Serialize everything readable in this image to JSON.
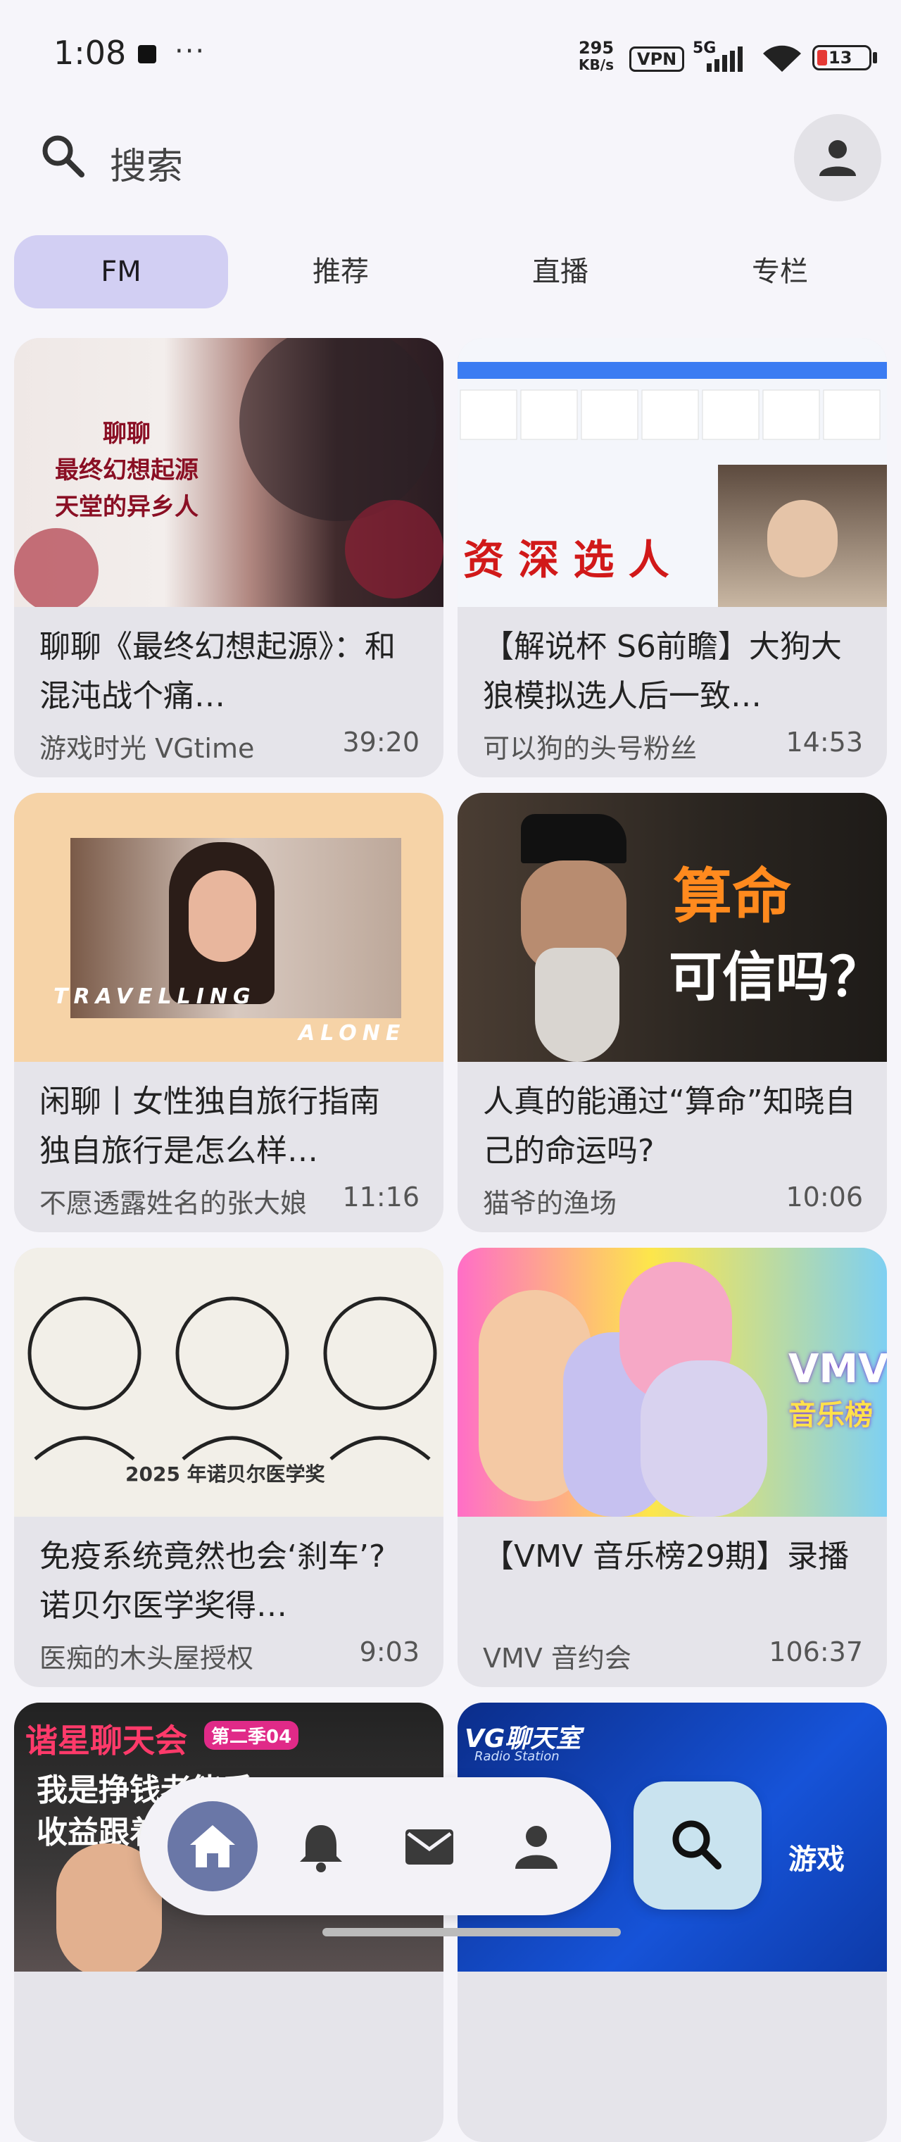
{
  "status_bar": {
    "time": "1:08",
    "dots": "···",
    "net_speed_value": "295",
    "net_speed_unit": "KB/s",
    "vpn": "VPN",
    "network": "5G",
    "battery": "13"
  },
  "search": {
    "placeholder": "搜索"
  },
  "tabs": [
    {
      "label": "FM",
      "active": true
    },
    {
      "label": "推荐",
      "active": false
    },
    {
      "label": "直播",
      "active": false
    },
    {
      "label": "专栏",
      "active": false
    }
  ],
  "cards": [
    {
      "title": "聊聊《最终幻想起源》：和混沌战个痛…",
      "author": "游戏时光 VGtime",
      "duration": "39:20",
      "thumb_text": [
        "聊聊",
        "最终幻想起源",
        "天堂的异乡人"
      ]
    },
    {
      "title": "【解说杯 S6前瞻】大狗大狼模拟选人后一致…",
      "author": "可以狗的头号粉丝",
      "duration": "14:53",
      "thumb_text": [
        "资 深 选 人"
      ]
    },
    {
      "title": "闲聊丨女性独自旅行指南 独自旅行是怎么样…",
      "author": "不愿透露姓名的张大娘",
      "duration": "11:16",
      "thumb_text": [
        "TRAVELLING",
        "ALONE"
      ]
    },
    {
      "title": "人真的能通过“算命”知晓自己的命运吗?",
      "author": "猫爷的渔场",
      "duration": "10:06",
      "thumb_text": [
        "算命",
        "可信吗？"
      ]
    },
    {
      "title": "免疫系统竟然也会‘刹车’? 诺贝尔医学奖得…",
      "author": "医痴的木头屋授权",
      "duration": "9:03",
      "thumb_text": [
        "2025 年诺贝尔医学奖"
      ]
    },
    {
      "title": "【VMV 音乐榜29期】录播",
      "author": "VMV 音约会",
      "duration": "106:37",
      "thumb_text": [
        "VMV",
        "音乐榜"
      ]
    },
    {
      "title": "",
      "author": "",
      "duration": "",
      "thumb_text": [
        "谐星聊天会",
        "第二季04",
        "我是挣钱老能手",
        "收益跟着"
      ]
    },
    {
      "title": "",
      "author": "",
      "duration": "",
      "thumb_text": [
        "VG聊天室",
        "Radio Station",
        "游戏"
      ]
    }
  ],
  "nav": {
    "items": [
      "home-icon",
      "bell-icon",
      "mail-icon",
      "person-icon"
    ],
    "fab": "search-icon"
  },
  "colors": {
    "active_tab": "#d2cff3",
    "home_button": "#6a77a7",
    "fab": "#c9e3ef",
    "card": "#e5e4ea"
  }
}
